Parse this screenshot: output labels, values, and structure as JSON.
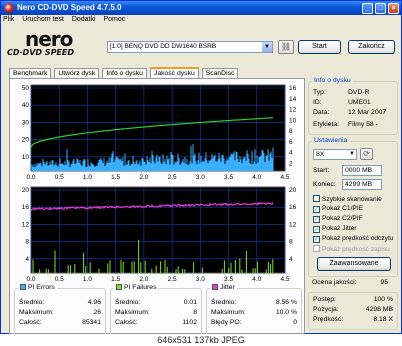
{
  "window": {
    "title": "Nero CD-DVD Speed 4.7.5.0",
    "menu": [
      "Plik",
      "Uruchom test",
      "Dodatki",
      "Pomoc"
    ]
  },
  "logo": {
    "brand": "nero",
    "product": "CD·DVD SPEED"
  },
  "toolbar": {
    "drive": "[1:0]  BENQ DVD DD DW1640 BSRB",
    "start_label": "Start",
    "close_label": "Zakończ"
  },
  "tabs": [
    "Benchmark",
    "Utwórz dysk",
    "Info o dysku",
    "Jakość dysku",
    "ScanDisc"
  ],
  "active_tab": "Jakość dysku",
  "top_graph": {
    "y_left_ticks": [
      "50",
      "40",
      "30",
      "20",
      "10"
    ],
    "y_right_ticks": [
      "16",
      "14",
      "12",
      "10",
      "8",
      "6",
      "4",
      "2"
    ],
    "x_ticks": [
      "0.0",
      "0.5",
      "1.0",
      "1.5",
      "2.0",
      "2.5",
      "3.0",
      "3.5",
      "4.0",
      "4.5"
    ]
  },
  "bottom_graph": {
    "y_left_ticks": [
      "20",
      "16",
      "12",
      "8",
      "4"
    ],
    "y_right_ticks": [
      "20",
      "16",
      "12",
      "8",
      "4"
    ],
    "x_ticks": [
      "0.0",
      "0.5",
      "1.0",
      "1.5",
      "2.0",
      "2.5",
      "3.0",
      "3.5",
      "4.0",
      "4.5"
    ]
  },
  "stats": {
    "pi_errors": {
      "title": "PI Errors",
      "color": "#38b0ff",
      "rows": [
        [
          "Średnio:",
          "4.96"
        ],
        [
          "Maksimum:",
          "26"
        ],
        [
          "Całość:",
          "85341"
        ]
      ]
    },
    "pi_failures": {
      "title": "PI Failures",
      "color": "#7be02a",
      "rows": [
        [
          "Średnio:",
          "0.01"
        ],
        [
          "Maksimum:",
          "8"
        ],
        [
          "Całość:",
          "1102"
        ]
      ]
    },
    "jitter": {
      "title": "Jitter",
      "color": "#e83ad8",
      "rows": [
        [
          "Średnio:",
          "8.56 %"
        ],
        [
          "Maksimum:",
          "10.0 %"
        ],
        [
          "Błędy PO:",
          "0"
        ]
      ]
    }
  },
  "disc_info": {
    "title": "Info o dysku",
    "rows": [
      [
        "Typ:",
        "DVD-R"
      ],
      [
        "ID:",
        "UME01"
      ],
      [
        "Data:",
        "12 Mar 2007"
      ],
      [
        "Etykieta:",
        "Filmy 58 -"
      ]
    ]
  },
  "settings": {
    "title": "Ustawienia",
    "speed": "8X",
    "start_label": "Start:",
    "start_value": "0000 MB",
    "end_label": "Koniec:",
    "end_value": "4299 MB",
    "checkboxes": [
      {
        "label": "Szybkie skanowanie",
        "checked": false,
        "disabled": false
      },
      {
        "label": "Pokaż C1/PIE",
        "checked": true,
        "disabled": false
      },
      {
        "label": "Pokaż C2/PIF",
        "checked": true,
        "disabled": false
      },
      {
        "label": "Pokaż Jitter",
        "checked": true,
        "disabled": false
      },
      {
        "label": "Pokaż prędkość odczytu",
        "checked": true,
        "disabled": false
      },
      {
        "label": "Pokaż prędkość zapisu",
        "checked": false,
        "disabled": true
      }
    ],
    "advanced_label": "Zaawansowane"
  },
  "quality": {
    "label": "Ocena jakości:",
    "value": "95"
  },
  "progress": {
    "rows": [
      [
        "Postęp:",
        "100 %"
      ],
      [
        "Pozycja:",
        "4298 MB"
      ],
      [
        "Prędkość:",
        "8.18 X"
      ]
    ]
  },
  "statusbar": {
    "text": "646x531  137kb  JPEG"
  },
  "colors": {
    "pi_errors": "#38b0ff",
    "pi_failures": "#7be02a",
    "jitter": "#e83ad8",
    "read_speed": "#2ad12a",
    "graph_bg": "#000000",
    "grid": "#1a3cb4"
  }
}
